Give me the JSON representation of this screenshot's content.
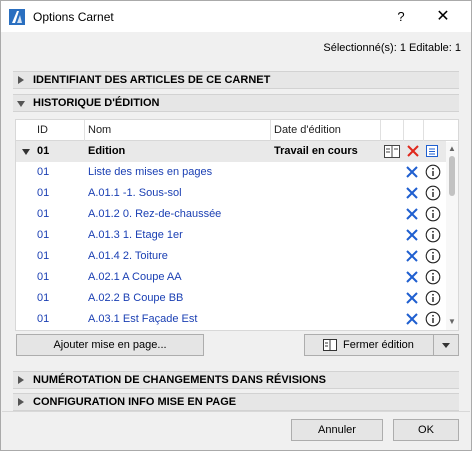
{
  "window": {
    "title": "Options Carnet",
    "help_label": "?",
    "close_label": "✕"
  },
  "selected_info": "Sélectionné(s): 1 Editable: 1",
  "sections": {
    "identifiant": "IDENTIFIANT DES ARTICLES DE CE CARNET",
    "historique": "HISTORIQUE D'ÉDITION",
    "numerotation": "NUMÉROTATION DE CHANGEMENTS DANS RÉVISIONS",
    "configuration": "CONFIGURATION INFO MISE EN PAGE"
  },
  "table": {
    "headers": {
      "id": "ID",
      "nom": "Nom",
      "date": "Date d'édition"
    },
    "group": {
      "id": "01",
      "nom": "Edition",
      "date": "Travail en cours"
    },
    "rows": [
      {
        "id": "01",
        "nom": "Liste des mises en pages"
      },
      {
        "id": "01",
        "nom": "A.01.1 -1. Sous-sol"
      },
      {
        "id": "01",
        "nom": "A.01.2 0. Rez-de-chaussée"
      },
      {
        "id": "01",
        "nom": "A.01.3 1. Etage 1er"
      },
      {
        "id": "01",
        "nom": "A.01.4 2. Toiture"
      },
      {
        "id": "01",
        "nom": "A.02.1 A Coupe AA"
      },
      {
        "id": "01",
        "nom": "A.02.2 B Coupe BB"
      },
      {
        "id": "01",
        "nom": "A.03.1 Est Façade Est"
      }
    ]
  },
  "buttons": {
    "add_layout": "Ajouter mise en page...",
    "close_edition": "Fermer édition",
    "cancel": "Annuler",
    "ok": "OK"
  },
  "colors": {
    "accent_blue": "#1a3fb3",
    "remove_blue": "#1f5fd0",
    "remove_red": "#e0281c"
  }
}
